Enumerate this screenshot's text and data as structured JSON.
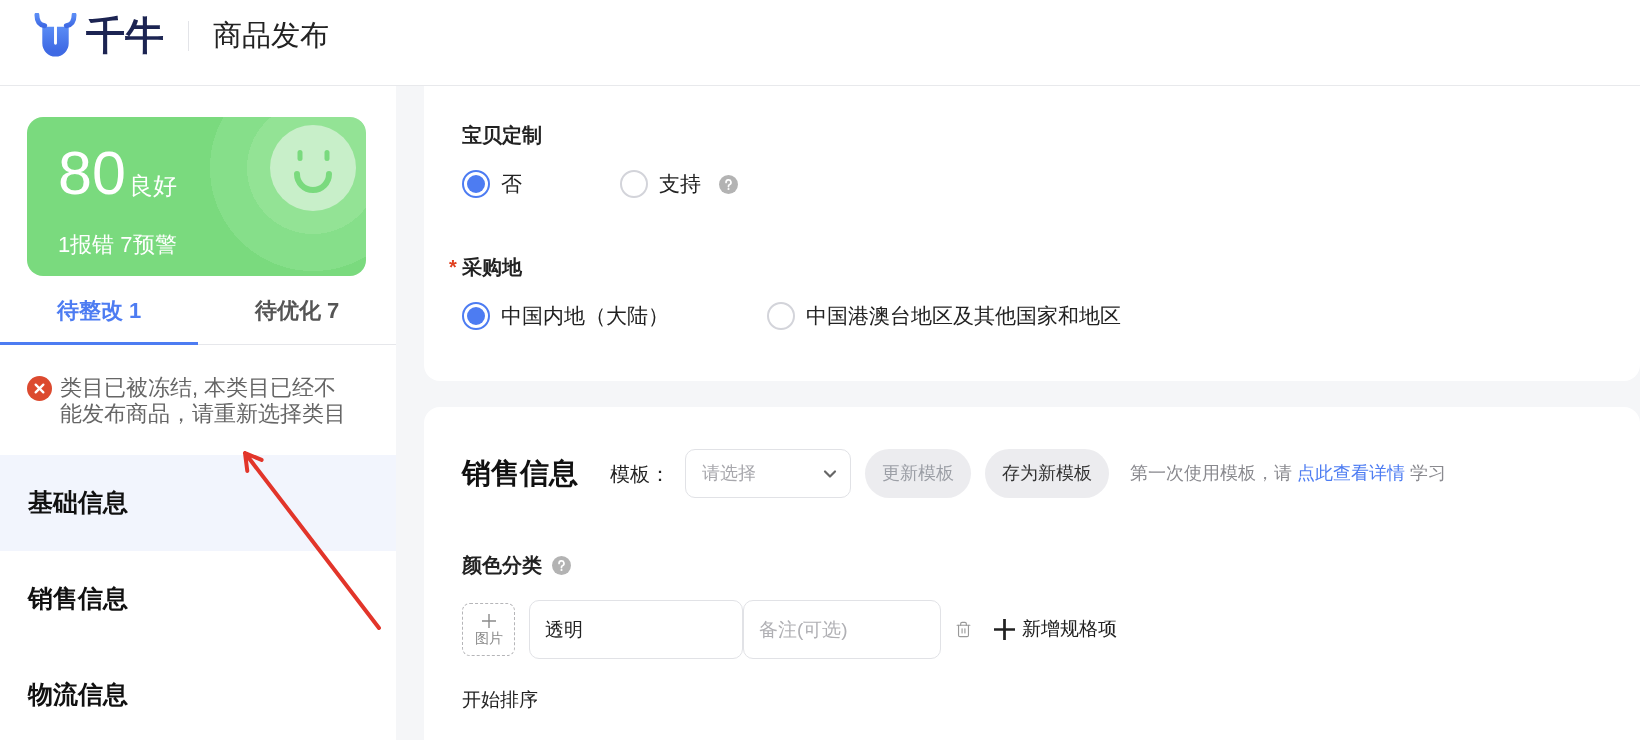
{
  "header": {
    "logo_text": "千牛",
    "title": "商品发布"
  },
  "score_card": {
    "score": "80",
    "grade": "良好",
    "summary": "1报错 7预警"
  },
  "issue_tabs": [
    {
      "label": "待整改 1",
      "selected": true
    },
    {
      "label": "待优化 7",
      "selected": false
    }
  ],
  "issues": [
    {
      "kind": "error",
      "text": "类目已被冻结, 本类目已经不能发布商品，请重新选择类目"
    }
  ],
  "sidebar": {
    "items": [
      {
        "label": "基础信息",
        "selected": true
      },
      {
        "label": "销售信息",
        "selected": false
      },
      {
        "label": "物流信息",
        "selected": false
      }
    ]
  },
  "customization": {
    "label": "宝贝定制",
    "options": [
      {
        "label": "否",
        "selected": true,
        "help": false
      },
      {
        "label": "支持",
        "selected": false,
        "help": true
      }
    ]
  },
  "purchase_origin": {
    "required_mark": "*",
    "label": "采购地",
    "options": [
      {
        "label": "中国内地（大陆）",
        "selected": true
      },
      {
        "label": "中国港澳台地区及其他国家和地区",
        "selected": false
      }
    ]
  },
  "sales": {
    "title": "销售信息",
    "template_label": "模板：",
    "template_select": {
      "placeholder": "请选择"
    },
    "buttons": [
      {
        "label": "更新模板",
        "disabled": true
      },
      {
        "label": "存为新模板",
        "disabled": false
      }
    ],
    "hint": {
      "text_before": "第一次使用模板，请",
      "link": "点此查看详情",
      "text_after": "学习"
    }
  },
  "color_group": {
    "label": "颜色分类",
    "upload_label": "图片",
    "value": "透明",
    "note_placeholder": "备注(可选)",
    "add_button": "新增规格项"
  },
  "sort_label": "开始排序"
}
